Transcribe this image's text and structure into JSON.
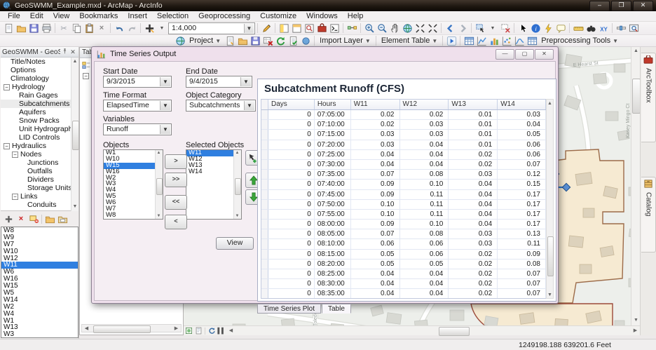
{
  "window": {
    "title": "GeoSWMM_Example.mxd - ArcMap - ArcInfo",
    "buttons": [
      "minimize",
      "maximize",
      "close"
    ]
  },
  "menu": {
    "items": [
      "File",
      "Edit",
      "View",
      "Bookmarks",
      "Insert",
      "Selection",
      "Geoprocessing",
      "Customize",
      "Windows",
      "Help"
    ]
  },
  "toolbar1": {
    "groupA": [
      "new-document",
      "open-folder",
      "save-floppy",
      "print"
    ],
    "groupB": [
      "cut-scissors",
      "copy-pages",
      "paste-clipboard",
      "delete-x"
    ],
    "groupC": [
      "undo-arrow",
      "redo-arrow"
    ],
    "groupD": [
      "add-data-plus",
      "caret"
    ],
    "scale_value": "1:4,000",
    "groupE": [
      "editor-pencil"
    ],
    "groupF": [
      "toc-panel",
      "catalog-window",
      "search-window",
      "toolbox-window",
      "python-window"
    ],
    "groupG": [
      "model-builder"
    ],
    "groupH": [
      "zoom-in-magnifier",
      "zoom-out-magnifier",
      "pan-hand",
      "full-extent-globe",
      "fixed-zoom-in",
      "fixed-zoom-out"
    ],
    "groupI": [
      "back-arrow",
      "forward-arrow"
    ],
    "groupJ": [
      "select-features",
      "caret",
      "clear-selection"
    ],
    "groupK": [
      "select-elements-arrow",
      "identify-info",
      "hyperlink-lightning",
      "html-popup"
    ],
    "groupL": [
      "measure-ruler",
      "find-binoculars",
      "go-to-xy"
    ],
    "groupM": [
      "time-slider",
      "viewer-window"
    ]
  },
  "toolbar2": {
    "lead_icon": "project-globe",
    "project_label": "Project",
    "icons1": [
      "new-project-page",
      "open-folder",
      "save-floppy",
      "delete-table-red",
      "refresh-arrows",
      "validate-page",
      "commit-dot"
    ],
    "import_layer_label": "Import Layer",
    "element_table_label": "Element Table",
    "icons2": [
      "run-play"
    ],
    "icons3": [
      "table-grid",
      "plot-line",
      "bar-chart",
      "scatter-chart",
      "profile-chart",
      "table-grid2"
    ],
    "preprocessing_label": "Preprocessing Tools"
  },
  "geoswmm_panel": {
    "title": "GeoSWMM - GeoSW...",
    "header_buttons": [
      "pin",
      "close"
    ],
    "tree": [
      {
        "label": "Title/Notes",
        "depth": 0
      },
      {
        "label": "Options",
        "depth": 0
      },
      {
        "label": "Climatology",
        "depth": 0
      },
      {
        "label": "Hydrology",
        "depth": 0,
        "box": true
      },
      {
        "label": "Rain Gages",
        "depth": 1
      },
      {
        "label": "Subcatchments",
        "depth": 1,
        "selected": true
      },
      {
        "label": "Aquifers",
        "depth": 1
      },
      {
        "label": "Snow Packs",
        "depth": 1
      },
      {
        "label": "Unit Hydrographs",
        "depth": 1
      },
      {
        "label": "LID Controls",
        "depth": 1
      },
      {
        "label": "Hydraulics",
        "depth": 0,
        "box": true
      },
      {
        "label": "Nodes",
        "depth": 1,
        "box": true
      },
      {
        "label": "Junctions",
        "depth": 2
      },
      {
        "label": "Outfalls",
        "depth": 2
      },
      {
        "label": "Dividers",
        "depth": 2
      },
      {
        "label": "Storage Units",
        "depth": 2
      },
      {
        "label": "Links",
        "depth": 1,
        "box": true
      },
      {
        "label": "Conduits",
        "depth": 2
      }
    ],
    "toolbar_icons": [
      "add-plus",
      "delete-red-x",
      "remove-layer",
      "open-folder-small",
      "save-folder-small"
    ],
    "list_items": [
      "W8",
      "W9",
      "W7",
      "W10",
      "W12",
      "W11",
      "W6",
      "W16",
      "W15",
      "W5",
      "W14",
      "W2",
      "W4",
      "W1",
      "W13",
      "W3"
    ],
    "selected_list_item": "W11"
  },
  "toc_panel": {
    "title_fragment": "Tab"
  },
  "dialog": {
    "title": "Time Series Output",
    "title_icon": "chart-icon",
    "buttons": [
      "minimize",
      "maximize",
      "close"
    ],
    "fields": {
      "start_date": {
        "label": "Start Date",
        "value": "9/3/2015"
      },
      "end_date": {
        "label": "End Date",
        "value": "9/4/2015"
      },
      "time_format": {
        "label": "Time Format",
        "value": "ElapsedTime"
      },
      "object_category": {
        "label": "Object Category",
        "value": "Subcatchments"
      },
      "variables": {
        "label": "Variables",
        "value": "Runoff"
      }
    },
    "objects": {
      "label": "Objects",
      "items": [
        "W1",
        "W10",
        "W15",
        "W16",
        "W2",
        "W3",
        "W4",
        "W5",
        "W6",
        "W7",
        "W8"
      ],
      "selected": "W15"
    },
    "selected_objects": {
      "label": "Selected Objects",
      "items": [
        "W11",
        "W12",
        "W13",
        "W14"
      ],
      "selected": "W11"
    },
    "transfer_buttons": [
      ">",
      ">>",
      "<<",
      "<"
    ],
    "side_buttons": [
      "select-on-map",
      "move-up-arrow",
      "move-down-arrow"
    ],
    "view_button": "View",
    "tabs": [
      {
        "label": "Time Series Plot",
        "active": false
      },
      {
        "label": "Table",
        "active": true
      }
    ],
    "table": {
      "title": "Subcatchment Runoff (CFS)",
      "columns": [
        "Days",
        "Hours",
        "W11",
        "W12",
        "W13",
        "W14"
      ],
      "rows": [
        [
          "0",
          "07:05:00",
          "0.02",
          "0.02",
          "0.01",
          "0.03"
        ],
        [
          "0",
          "07:10:00",
          "0.02",
          "0.03",
          "0.01",
          "0.04"
        ],
        [
          "0",
          "07:15:00",
          "0.03",
          "0.03",
          "0.01",
          "0.05"
        ],
        [
          "0",
          "07:20:00",
          "0.03",
          "0.04",
          "0.01",
          "0.06"
        ],
        [
          "0",
          "07:25:00",
          "0.04",
          "0.04",
          "0.02",
          "0.06"
        ],
        [
          "0",
          "07:30:00",
          "0.04",
          "0.04",
          "0.02",
          "0.07"
        ],
        [
          "0",
          "07:35:00",
          "0.07",
          "0.08",
          "0.03",
          "0.12"
        ],
        [
          "0",
          "07:40:00",
          "0.09",
          "0.10",
          "0.04",
          "0.15"
        ],
        [
          "0",
          "07:45:00",
          "0.09",
          "0.11",
          "0.04",
          "0.17"
        ],
        [
          "0",
          "07:50:00",
          "0.10",
          "0.11",
          "0.04",
          "0.17"
        ],
        [
          "0",
          "07:55:00",
          "0.10",
          "0.11",
          "0.04",
          "0.17"
        ],
        [
          "0",
          "08:00:00",
          "0.09",
          "0.10",
          "0.04",
          "0.17"
        ],
        [
          "0",
          "08:05:00",
          "0.07",
          "0.08",
          "0.03",
          "0.13"
        ],
        [
          "0",
          "08:10:00",
          "0.06",
          "0.06",
          "0.03",
          "0.11"
        ],
        [
          "0",
          "08:15:00",
          "0.05",
          "0.06",
          "0.02",
          "0.09"
        ],
        [
          "0",
          "08:20:00",
          "0.05",
          "0.05",
          "0.02",
          "0.08"
        ],
        [
          "0",
          "08:25:00",
          "0.04",
          "0.04",
          "0.02",
          "0.07"
        ],
        [
          "0",
          "08:30:00",
          "0.04",
          "0.04",
          "0.02",
          "0.07"
        ],
        [
          "0",
          "08:35:00",
          "0.04",
          "0.04",
          "0.02",
          "0.07"
        ]
      ]
    }
  },
  "map": {
    "street_labels": [
      "E Hearst St",
      "Kasey Mingo Ct",
      "Toledo St"
    ],
    "colors": {
      "subcatchment_fill": "#f6ead2",
      "subcatchment_outline": "#9c6b49",
      "conduit_blue": "#2e79d0",
      "building_gray": "#d8d9d3"
    }
  },
  "right_tabs": [
    {
      "label": "ArcToolbox",
      "icon": "toolbox-red-icon"
    },
    {
      "label": "Catalog",
      "icon": "catalog-cabinet-icon"
    }
  ],
  "statusbar": {
    "coordinates": "1249198.188  639201.6 Feet"
  }
}
